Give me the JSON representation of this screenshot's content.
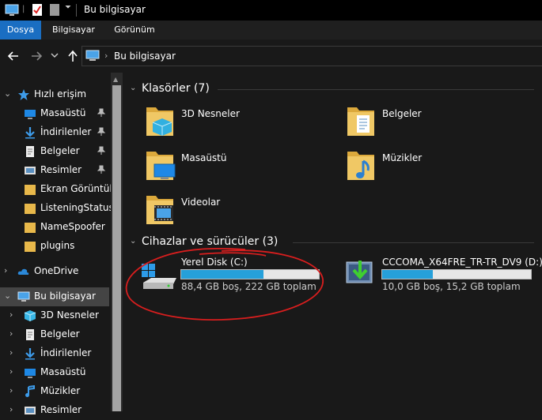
{
  "window": {
    "title": "Bu bilgisayar"
  },
  "ribbon": {
    "tabs": [
      "Dosya",
      "Bilgisayar",
      "Görünüm"
    ]
  },
  "address": {
    "path": "Bu bilgisayar"
  },
  "sidebar": {
    "quick_access": "Hızlı erişim",
    "quick_items": [
      "Masaüstü",
      "İndirilenler",
      "Belgeler",
      "Resimler",
      "Ekran Görüntüle",
      "ListeningStatus",
      "NameSpoofer",
      "plugins"
    ],
    "onedrive": "OneDrive",
    "this_pc": "Bu bilgisayar",
    "pc_items": [
      "3D Nesneler",
      "Belgeler",
      "İndirilenler",
      "Masaüstü",
      "Müzikler",
      "Resimler"
    ]
  },
  "main": {
    "folders_header": "Klasörler (7)",
    "folders": [
      "3D Nesneler",
      "Belgeler",
      "Masaüstü",
      "Müzikler",
      "Videolar"
    ],
    "devices_header": "Cihazlar ve sürücüler (3)",
    "drives": [
      {
        "name": "Yerel Disk (C:)",
        "info": "88,4 GB boş, 222 GB toplam",
        "used_fraction": 0.6
      },
      {
        "name": "CCCOMA_X64FRE_TR-TR_DV9 (D:)",
        "info": "10,0 GB boş, 15,2 GB toplam",
        "used_fraction": 0.34
      }
    ]
  },
  "colors": {
    "accent": "#1a6ec2",
    "bar_fill": "#26a0da",
    "annotation": "#d81e1e",
    "folder": "#e8b84a"
  }
}
